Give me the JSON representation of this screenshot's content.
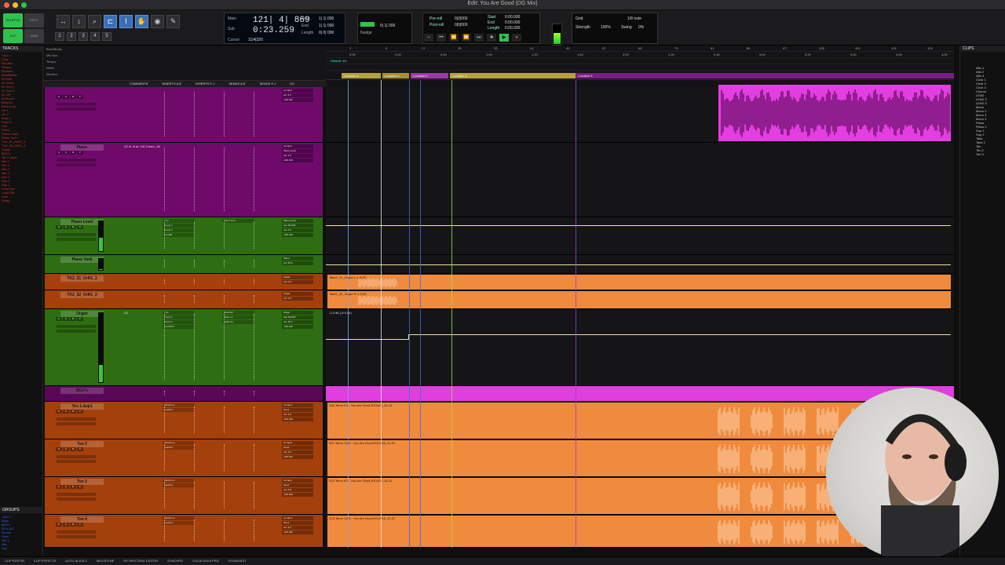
{
  "window": {
    "title": "Edit: You Are Good (DG Mix)"
  },
  "toolbar": {
    "modes": [
      "SHUFFLE",
      "SPOT",
      "SLIP",
      "GRID"
    ],
    "counter": {
      "main_label": "Main",
      "main_value": "121| 4| 869",
      "sub_label": "Sub",
      "sub_value": "0:23.259",
      "cursor_label": "Cursor",
      "cursor_value": "11|4|320",
      "start_label": "Start",
      "end_label": "End",
      "length_label": "Length",
      "start_value": "1| 1| 000",
      "end_value": "1| 1| 000",
      "length_value": "0| 0| 000"
    },
    "nudge": {
      "label": "Nudge",
      "value": "0| 1| 000"
    },
    "transport": {
      "preroll": "Pre-roll",
      "postroll": "Post-roll",
      "start": "Start",
      "end": "End",
      "length": "Length",
      "preroll_value": "0|2|000",
      "postroll_value": "0|0|000",
      "start_value": "0:00.000",
      "end_value": "0:00.000",
      "length_value": "0:00.000"
    },
    "grid": {
      "grid_label": "Grid",
      "grid_value": "1/8 note",
      "strength_label": "Strength",
      "strength_value": "100%",
      "swing_label": "Swing",
      "swing_value": "0%"
    }
  },
  "tracks_panel": {
    "header": "TRACKS",
    "items": [
      "<ALL>",
      "Click",
      "Mix Bus",
      "Tempo",
      "Markers",
      "BandBeats",
      "Dr Kick",
      "Dr Snare",
      "Dr Tom 1",
      "Dr Tom 2",
      "Dr OH",
      "Dr Room",
      "Bass DI",
      "Bass Amp",
      "Gtr 1",
      "Gtr 2",
      "Keys L",
      "Keys R",
      "Pad",
      "Piano",
      "Piano Level",
      "Piano Verb",
      "TK2_31_OrR1_3",
      "TK2_32_OrR1_3",
      "Organ",
      "BGV's",
      "Ten 1.dup1",
      "Ten 2",
      "Ten 3",
      "Ten 4",
      "Alto 1",
      "Alto 2",
      "Sop 1",
      "Sop 2",
      "Lead Vox",
      "Lead Dbl",
      "Verb",
      "Delay"
    ],
    "groups_header": "GROUPS",
    "groups": [
      "<ALL>",
      "Bass",
      "BGV's",
      "BV's ALT",
      "Drums",
      "Keys",
      "Ten 1",
      "Alto",
      "Sop"
    ]
  },
  "columns": {
    "header_labels": [
      "Bard/Beats",
      "Mix Bus",
      "Tempo",
      "Meter",
      "Markers"
    ],
    "heads": [
      "COMMENTS",
      "INSERTS A-E",
      "INSERTS F-J",
      "SENDS A-E",
      "SENDS F-J",
      "I/O"
    ]
  },
  "strips": [
    {
      "name": "",
      "color": "#6f0a6a",
      "comment": "",
      "inserts": [],
      "io": [
        "no input",
        "vol -2.3",
        "-100 100"
      ]
    },
    {
      "name": "Piano",
      "color": "#6f0a6a",
      "comment": "-12 lo -8 or +10.3 from -18",
      "inserts": [],
      "io": [
        "no input",
        "Piano Level",
        "vol -1.5",
        "-100 100"
      ]
    },
    {
      "name": "Piano Level",
      "color": "#2e6d12",
      "comment": "",
      "inserts": [
        "Trim",
        "Pro-Q 3",
        "Pro-Q 4",
        "Pro-MB"
      ],
      "sends": [
        "Piano Verb"
      ],
      "io": [
        "Piano Level",
        "ALL MUSIC",
        "vol -4.5",
        "-100 100"
      ]
    },
    {
      "name": "Piano Verb",
      "color": "#2e6d12",
      "comment": "",
      "inserts": [],
      "io": [
        "Piano",
        "vol -10.3"
      ]
    },
    {
      "name": "TK2_31_OrR1_3",
      "color": "#a4400c",
      "comment": "",
      "inserts": [],
      "io": [
        "Organ",
        "vol -0.0"
      ]
    },
    {
      "name": "TK2_32_OrR1_3",
      "color": "#a4400c",
      "comment": "",
      "inserts": [],
      "io": [
        "Organ",
        "vol -0.0"
      ]
    },
    {
      "name": "Organ",
      "color": "#2e6d12",
      "comment": "-13",
      "inserts": [
        "Trim",
        "Pro-Q 3",
        "Pro-Q 4",
        "CHORUS"
      ],
      "sends": [
        "BlueVerb",
        "Saturn 2",
        "LgtRoom"
      ],
      "io": [
        "Organ",
        "ALL MUSIC",
        "vol -10.7",
        "-100 100"
      ]
    },
    {
      "name": "BGV's",
      "color": "#5b0758",
      "comment": "",
      "inserts": [],
      "io": []
    },
    {
      "name": "Ten 1.dup1",
      "color": "#a4400c",
      "comment": "",
      "inserts": [
        "MetaTune",
        "LeadVox"
      ],
      "io": [
        "no input",
        "Tenor",
        "vol -2.6",
        "-100 100"
      ]
    },
    {
      "name": "Ten 2",
      "color": "#a4400c",
      "comment": "",
      "inserts": [
        "MetaTune",
        "LeadVox"
      ],
      "io": [
        "no input",
        "Tenor",
        "vol -2.6",
        "-100 100"
      ]
    },
    {
      "name": "Ten 3",
      "color": "#a4400c",
      "comment": "",
      "inserts": [
        "MetaTune",
        "LeadVox"
      ],
      "io": [
        "no input",
        "Tenor",
        "vol -3.8",
        "-100 100"
      ]
    },
    {
      "name": "Ten 4",
      "color": "#a4400c",
      "comment": "",
      "inserts": [
        "MetaTune",
        "LeadVox"
      ],
      "io": [
        "no input",
        "Tenor",
        "vol -2.4",
        "-100 100"
      ]
    }
  ],
  "timeline": {
    "rulers": [
      "Bars|Beats",
      "Min:Secs",
      "Tempo",
      "Meter",
      "Markers"
    ],
    "bar_ticks": [
      "1",
      "9",
      "17",
      "25",
      "33",
      "41",
      "49",
      "57",
      "65",
      "73",
      "81",
      "89",
      "97",
      "105",
      "113",
      "121",
      "129",
      "137"
    ],
    "minsec_ticks": [
      "0:00",
      "0:20",
      "0:40",
      "1:00",
      "1:20",
      "1:40",
      "2:00",
      "2:20",
      "2:40",
      "3:00",
      "3:20",
      "3:40",
      "4:00",
      "4:20"
    ],
    "tempo": "Default: 4/4",
    "markers": [
      "Location 8",
      "Location 9",
      "Location 2",
      "Location 4",
      "Location 5"
    ],
    "clips": [
      {
        "lane": 4,
        "label": "Take2_31_Organ L-1-3-02"
      },
      {
        "lane": 5,
        "label": "Take2_32_Organ R-1-3-02"
      },
      {
        "lane": 6,
        "label": "-0.3 db (-8.5 db)"
      },
      {
        "lane": 8,
        "label": "006-Tenor K3 - You Are Good-RX11Dlt_01-01"
      },
      {
        "lane": 9,
        "label": "007-Tenor CAD - You Are Good-RX11Dlt_01-01"
      },
      {
        "lane": 10,
        "label": "012-Tenor K3 - You Are Good-RX11Dlt_01-01"
      },
      {
        "lane": 11,
        "label": "013-Tenor CAD - You Are Good-RX11Dlt_01-01"
      }
    ]
  },
  "clips_panel": {
    "header": "CLIPS",
    "items": [
      "Alto 1",
      "Alto 2",
      "Alto 3",
      "Choir 1",
      "Choir 2",
      "Choir 3",
      "Chorus",
      "LEAD",
      "LEAD 2",
      "LEAD 3",
      "Mono",
      "Mono 2",
      "Mono 3",
      "Mono 4",
      "Piano",
      "Piano 2",
      "Sop 1",
      "Sop 2",
      "Take",
      "Take 2",
      "Ten",
      "Ten 2",
      "Ten 3"
    ]
  },
  "bottombar": [
    "CLIP EDITOR",
    "CLIP EFFECTS",
    "AUTO-ALIGN 2",
    "MELODYNE",
    "RX SPECTRAL EDITOR",
    "SYNCHRO",
    "VOCALIGN 6 PRO",
    "DYNASSIST"
  ],
  "colors": {
    "purple_clip": "#e33ee0",
    "orange_clip": "#f08a3c",
    "green_strip": "#2e6d12",
    "orange_strip": "#a4400c",
    "purple_strip": "#6f0a6a"
  }
}
